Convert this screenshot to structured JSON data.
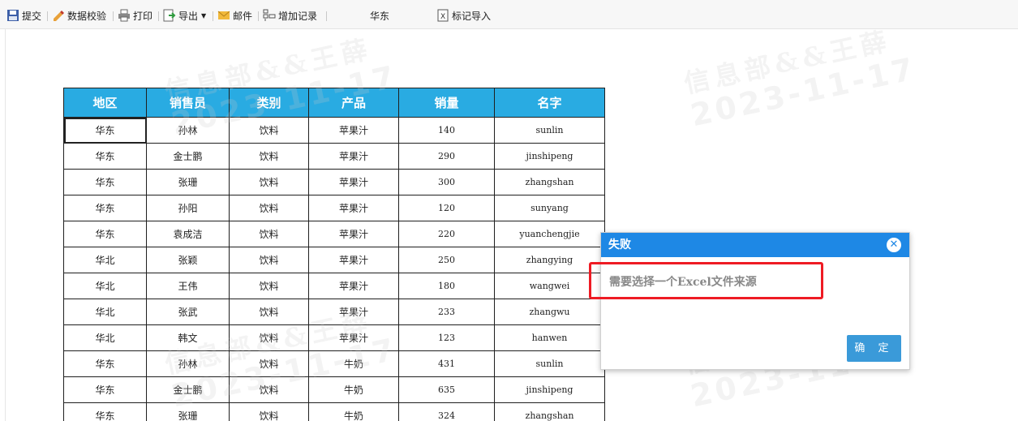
{
  "toolbar": {
    "submit": "提交",
    "validate": "数据校验",
    "print": "打印",
    "export": "导出",
    "email": "邮件",
    "add_record": "增加记录",
    "region_value": "华东",
    "tag_import": "标记导入"
  },
  "watermark": {
    "line1": "信息部&&王薛",
    "line2": "2023-11-17"
  },
  "table": {
    "headers": [
      "地区",
      "销售员",
      "类别",
      "产品",
      "销量",
      "名字"
    ],
    "rows": [
      [
        "华东",
        "孙林",
        "饮料",
        "苹果汁",
        "140",
        "sunlin"
      ],
      [
        "华东",
        "金士鹏",
        "饮料",
        "苹果汁",
        "290",
        "jinshipeng"
      ],
      [
        "华东",
        "张珊",
        "饮料",
        "苹果汁",
        "300",
        "zhangshan"
      ],
      [
        "华东",
        "孙阳",
        "饮料",
        "苹果汁",
        "120",
        "sunyang"
      ],
      [
        "华东",
        "袁成洁",
        "饮料",
        "苹果汁",
        "220",
        "yuanchengjie"
      ],
      [
        "华北",
        "张颖",
        "饮料",
        "苹果汁",
        "250",
        "zhangying"
      ],
      [
        "华北",
        "王伟",
        "饮料",
        "苹果汁",
        "180",
        "wangwei"
      ],
      [
        "华北",
        "张武",
        "饮料",
        "苹果汁",
        "233",
        "zhangwu"
      ],
      [
        "华北",
        "韩文",
        "饮料",
        "苹果汁",
        "123",
        "hanwen"
      ],
      [
        "华东",
        "孙林",
        "饮料",
        "牛奶",
        "431",
        "sunlin"
      ],
      [
        "华东",
        "金士鹏",
        "饮料",
        "牛奶",
        "635",
        "jinshipeng"
      ],
      [
        "华东",
        "张珊",
        "饮料",
        "牛奶",
        "324",
        "zhangshan"
      ]
    ]
  },
  "dialog": {
    "title": "失败",
    "message": "需要选择一个Excel文件来源",
    "ok_label": "确 定"
  },
  "colors": {
    "header_bg": "#29abe2",
    "dialog_header": "#1e88e5",
    "ok_button": "#3a9ad9",
    "highlight": "#ee1b24"
  }
}
